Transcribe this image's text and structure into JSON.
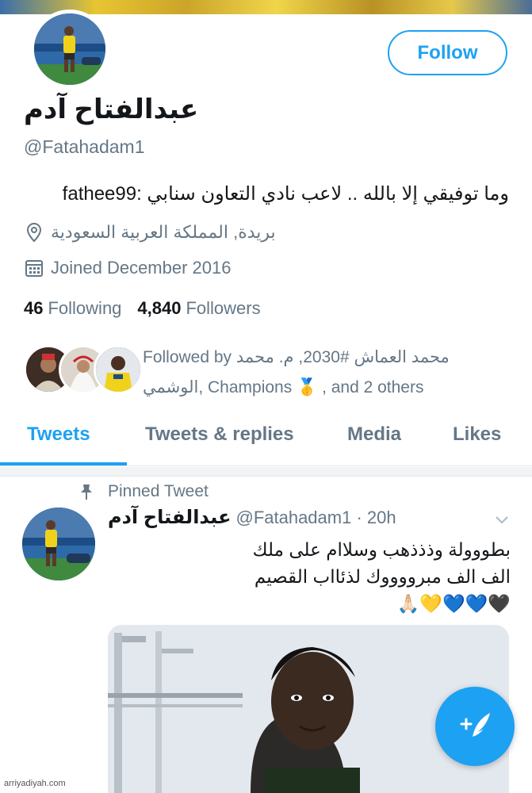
{
  "profile": {
    "display_name": "عبدالفتاح آدم",
    "handle": "@Fatahadam1",
    "follow_label": "Follow",
    "bio": "وما توفيقي إلا بالله .. لاعب نادي التعاون سنابي :fathee99",
    "location": "بريدة, المملكة العربية السعودية",
    "joined": "Joined December 2016",
    "following_count": "46",
    "following_label": "Following",
    "followers_count": "4,840",
    "followers_label": "Followers"
  },
  "mutuals": {
    "prefix": "Followed by",
    "names_line1": "محمد العماش #2030, م. محمد",
    "names_line2_rtl": "الوشمي",
    "champions": ", Champions",
    "medal": "🥇",
    "suffix": ", and 2 others"
  },
  "tabs": [
    {
      "label": "Tweets"
    },
    {
      "label": "Tweets & replies"
    },
    {
      "label": "Media"
    },
    {
      "label": "Likes"
    }
  ],
  "tweet": {
    "pinned_label": "Pinned Tweet",
    "author_name": "عبدالفتاح آدم",
    "author_handle": "@Fatahadam1 · 20h",
    "lines": [
      "بطووولة وذذذهب وسلاام على ملك",
      "الف الف مبرووووك لذئااب القصيم",
      "🖤💙💙💛🙏🏻"
    ]
  },
  "watermark": "arriyadiyah.com",
  "icons": {
    "location": "map-pin-icon",
    "calendar": "calendar-icon",
    "pin": "pin-icon",
    "chevron": "chevron-down-icon",
    "compose": "compose-tweet-icon"
  },
  "colors": {
    "accent": "#1da1f2",
    "secondary_text": "#657786",
    "primary_text": "#14171a"
  }
}
